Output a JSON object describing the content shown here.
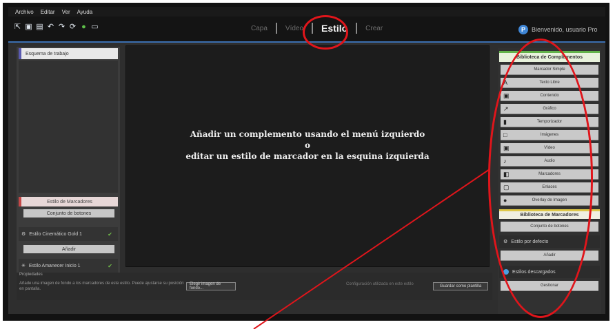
{
  "menubar": {
    "items": [
      "Archivo",
      "Editar",
      "Ver",
      "Ayuda"
    ]
  },
  "toolbar": {
    "icons": [
      "select-icon",
      "save-icon",
      "save-as-icon",
      "undo-icon",
      "redo-icon",
      "refresh-icon",
      "green-dot-icon",
      "screen-icon"
    ]
  },
  "modes": {
    "tabs": [
      {
        "label": "Capa",
        "active": false
      },
      {
        "label": "Vídeo",
        "active": false
      },
      {
        "label": "Estilo",
        "active": true
      },
      {
        "label": "Crear",
        "active": false
      }
    ]
  },
  "user": {
    "avatar_letter": "P",
    "name": "Bienvenido, usuario Pro"
  },
  "left_panel": {
    "header": "Esquema de trabajo",
    "styles_header": "Estilo de Marcadores",
    "new_style_button": "Conjunto de botones",
    "item1": "Estilo Cinemático Gold 1",
    "item1_check": "✔",
    "add_button": "Añadir",
    "item2": "Estilo Amanecer Inicio 1",
    "item2_check": "✔"
  },
  "canvas": {
    "line1": "Añadir un complemento usando el menú izquierdo",
    "line2": "o",
    "line3": "editar un estilo de marcador en la esquina izquierda"
  },
  "properties": {
    "label": "Propiedades",
    "description": "Añade una imagen de fondo a los marcadores de este estilo. Puede ajustarse su posición en pantalla.",
    "image_button": "Elegir imagen de fondo...",
    "hint": "Configuración utilizada en este estilo",
    "save_button": "Guardar como plantilla"
  },
  "right_panel": {
    "library_header": "Biblioteca de Complementos",
    "plugins": [
      {
        "label": "Marcador Simple",
        "icon": ""
      },
      {
        "label": "Texto Libre",
        "icon": "A"
      },
      {
        "label": "Contenido",
        "icon": "▣"
      },
      {
        "label": "Gráfico",
        "icon": "↗"
      },
      {
        "label": "Temporizador",
        "icon": "▮"
      },
      {
        "label": "Imágenes",
        "icon": "□"
      },
      {
        "label": "Vídeo",
        "icon": "▣"
      },
      {
        "label": "Audio",
        "icon": "♪"
      },
      {
        "label": "Marcadores",
        "icon": "◧"
      },
      {
        "label": "Enlaces",
        "icon": "▢"
      },
      {
        "label": "Overlay de Imagen",
        "icon": "●"
      }
    ],
    "markers_header": "Biblioteca de Marcadores",
    "markers_button": "Conjunto de botones",
    "default_style": "Estilo por defecto",
    "add_button": "Añadir",
    "downloaded": "Estilos descargados",
    "manage_button": "Gestionar"
  },
  "colors": {
    "highlight": "#e0151b",
    "accent_blue": "#3b6fb0",
    "plugin_green": "#62b24a",
    "marker_yellow": "#dfc84a"
  }
}
